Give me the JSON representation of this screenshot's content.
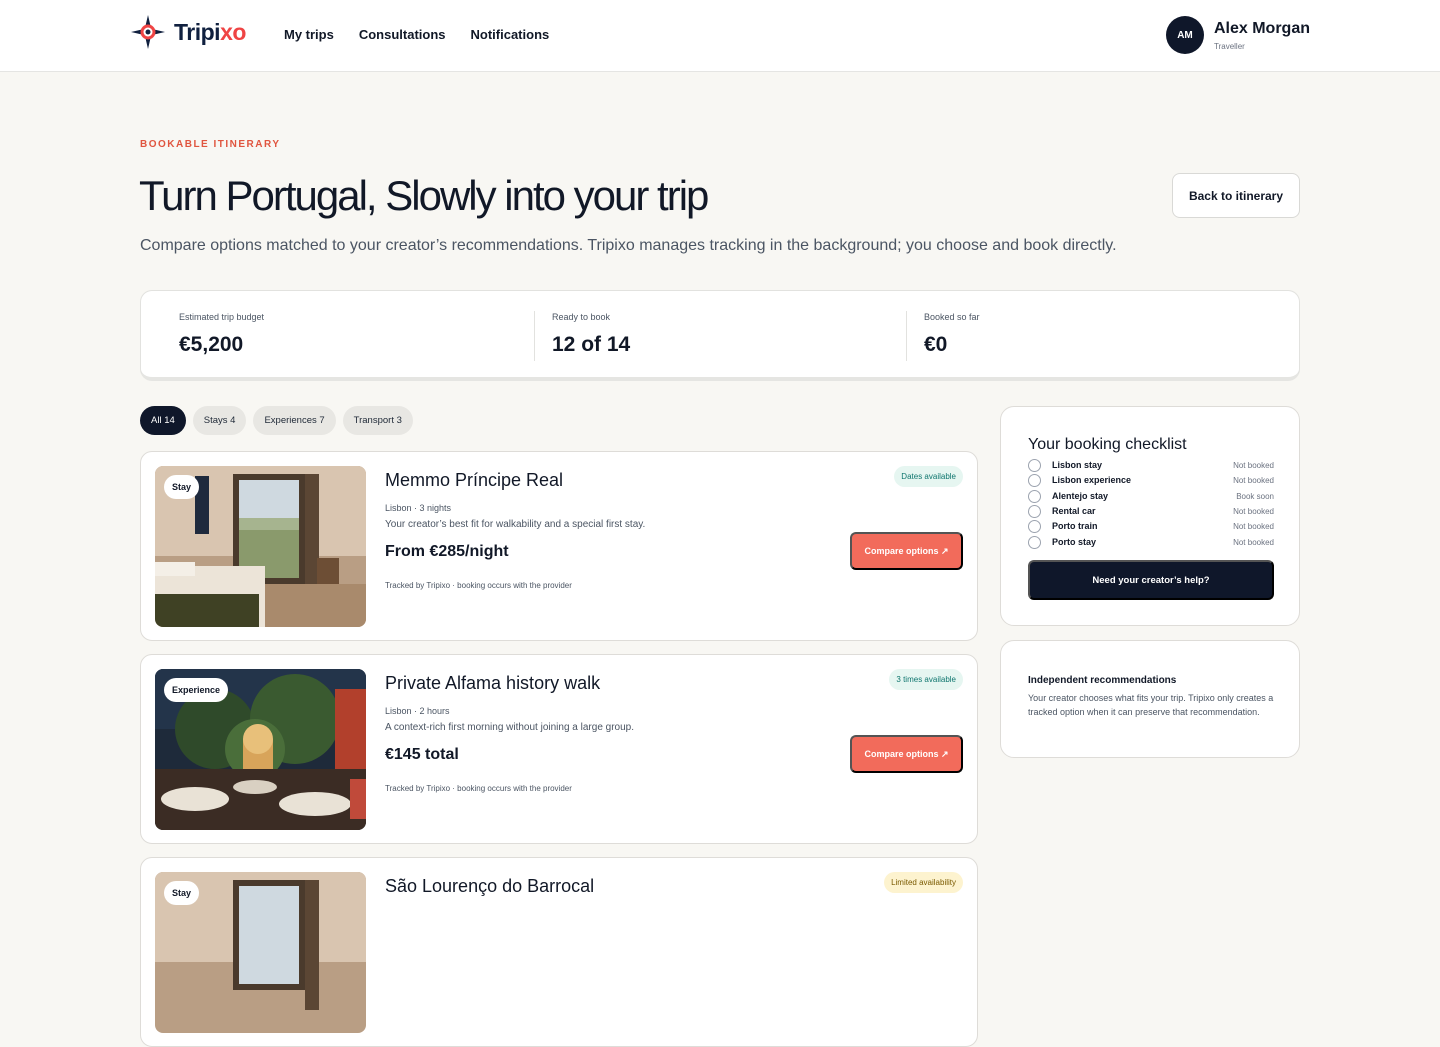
{
  "header": {
    "logo_text_a": "Tripi",
    "logo_text_b": "x",
    "logo_text_c": "o",
    "nav": [
      "My trips",
      "Consultations",
      "Notifications"
    ],
    "user": {
      "initials": "AM",
      "name": "Alex Morgan",
      "role": "Traveller"
    }
  },
  "hero": {
    "eyebrow": "BOOKABLE ITINERARY",
    "title": "Turn Portugal, Slowly into your trip",
    "subtitle": "Compare options matched to your creator’s recommendations. Tripixo manages tracking in the background; you choose and book directly.",
    "back_label": "Back to itinerary"
  },
  "stats": [
    {
      "label": "Estimated trip budget",
      "value": "€5,200"
    },
    {
      "label": "Ready to book",
      "value": "12 of 14"
    },
    {
      "label": "Booked so far",
      "value": "€0"
    }
  ],
  "filters": [
    {
      "label": "All 14",
      "active": true
    },
    {
      "label": "Stays 4",
      "active": false
    },
    {
      "label": "Experiences 7",
      "active": false
    },
    {
      "label": "Transport 3",
      "active": false
    }
  ],
  "cards": [
    {
      "tag": "Stay",
      "title": "Memmo Príncipe Real",
      "meta": "Lisbon · 3 nights",
      "desc": "Your creator’s best fit for walkability and a special first stay.",
      "price": "From €285/night",
      "foot": "Tracked by Tripixo · booking occurs with the provider",
      "availability": "Dates available",
      "availability_tone": "green",
      "cta": "Compare options ↗"
    },
    {
      "tag": "Experience",
      "title": "Private Alfama history walk",
      "meta": "Lisbon · 2 hours",
      "desc": "A context-rich first morning without joining a large group.",
      "price": "€145 total",
      "foot": "Tracked by Tripixo · booking occurs with the provider",
      "availability": "3 times available",
      "availability_tone": "green",
      "cta": "Compare options ↗"
    },
    {
      "tag": "Stay",
      "title": "São Lourenço do Barrocal",
      "availability": "Limited availability",
      "availability_tone": "yellow"
    }
  ],
  "checklist": {
    "title": "Your booking checklist",
    "items": [
      {
        "name": "Lisbon stay",
        "status": "Not booked"
      },
      {
        "name": "Lisbon experience",
        "status": "Not booked"
      },
      {
        "name": "Alentejo stay",
        "status": "Book soon"
      },
      {
        "name": "Rental car",
        "status": "Not booked"
      },
      {
        "name": "Porto train",
        "status": "Not booked"
      },
      {
        "name": "Porto stay",
        "status": "Not booked"
      }
    ],
    "help_label": "Need your creator’s help?"
  },
  "independent": {
    "title": "Independent recommendations",
    "text": "Your creator chooses what fits your trip. Tripixo only creates a tracked option when it can preserve that recommendation."
  },
  "colors": {
    "accent": "#f26b5b",
    "navy": "#0f172a",
    "eyebrow": "#e0553f",
    "background": "#f8f7f3"
  }
}
